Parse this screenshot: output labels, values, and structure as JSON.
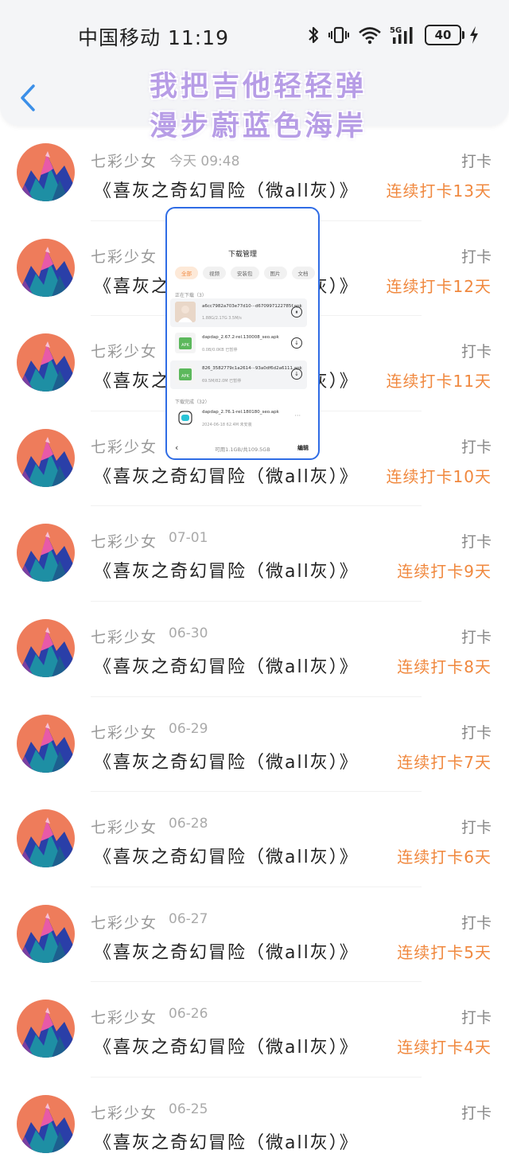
{
  "status_bar": {
    "carrier_time": "中国移动 11:19",
    "battery": "40",
    "network": "5G"
  },
  "overlay": {
    "line1": "我把吉他轻轻弹",
    "line2": "漫步蔚蓝色海岸"
  },
  "rows": [
    {
      "nickname": "七彩少女",
      "date": "今天 09:48",
      "book": "《喜灰之奇幻冒险（微all灰）》",
      "punch": "打卡",
      "streak": "连续打卡13天"
    },
    {
      "nickname": "七彩少女",
      "date": "",
      "book": "《喜灰之奇幻冒险（微all灰）》",
      "punch": "打卡",
      "streak": "连续打卡12天"
    },
    {
      "nickname": "七彩少女",
      "date": "",
      "book": "《喜灰之奇幻冒险（微all灰）》",
      "punch": "打卡",
      "streak": "连续打卡11天"
    },
    {
      "nickname": "七彩少女",
      "date": "",
      "book": "《喜灰之奇幻冒险（微all灰）》",
      "punch": "打卡",
      "streak": "连续打卡10天"
    },
    {
      "nickname": "七彩少女",
      "date": "07-01",
      "book": "《喜灰之奇幻冒险（微all灰）》",
      "punch": "打卡",
      "streak": "连续打卡9天"
    },
    {
      "nickname": "七彩少女",
      "date": "06-30",
      "book": "《喜灰之奇幻冒险（微all灰）》",
      "punch": "打卡",
      "streak": "连续打卡8天"
    },
    {
      "nickname": "七彩少女",
      "date": "06-29",
      "book": "《喜灰之奇幻冒险（微all灰）》",
      "punch": "打卡",
      "streak": "连续打卡7天"
    },
    {
      "nickname": "七彩少女",
      "date": "06-28",
      "book": "《喜灰之奇幻冒险（微all灰）》",
      "punch": "打卡",
      "streak": "连续打卡6天"
    },
    {
      "nickname": "七彩少女",
      "date": "06-27",
      "book": "《喜灰之奇幻冒险（微all灰）》",
      "punch": "打卡",
      "streak": "连续打卡5天"
    },
    {
      "nickname": "七彩少女",
      "date": "06-26",
      "book": "《喜灰之奇幻冒险（微all灰）》",
      "punch": "打卡",
      "streak": "连续打卡4天"
    },
    {
      "nickname": "七彩少女",
      "date": "06-25",
      "book": "《喜灰之奇幻冒险（微all灰）》",
      "punch": "打卡",
      "streak": ""
    }
  ],
  "download_panel": {
    "title": "下载管理",
    "tabs": [
      "全部",
      "视频",
      "安装包",
      "图片",
      "文档"
    ],
    "in_progress_label": "正在下载（3）",
    "items": [
      {
        "name": "a6cc7982a703e77d10···d670997122785f.apk",
        "meta": "1.88G/2.17G  3.5M/s",
        "action": "pause"
      },
      {
        "name": "dapdap_2.67.2-rel.130008_seo.apk",
        "meta": "0.0B/0.0KB  已暂停",
        "action": "download"
      },
      {
        "name": "826_3582779c1a2614···93a0df6d2a6111.apk",
        "meta": "69.5M/82.0M  已暂停",
        "action": "download"
      }
    ],
    "done_label": "下载完成（32）",
    "done_item": {
      "name": "dapdap_2.76.1-rel.180180_seo.apk",
      "meta": "2024-06-18  62.4M  未安装"
    },
    "footer_available": "可用1.1GB/共109.5GB",
    "footer_edit": "编辑",
    "colors": {
      "border": "#2f6ce5",
      "accent": "#f0883e"
    }
  },
  "colors": {
    "streak": "#f0883e",
    "overlay_text": "#b79de6",
    "back_arrow": "#3b8fe8"
  }
}
